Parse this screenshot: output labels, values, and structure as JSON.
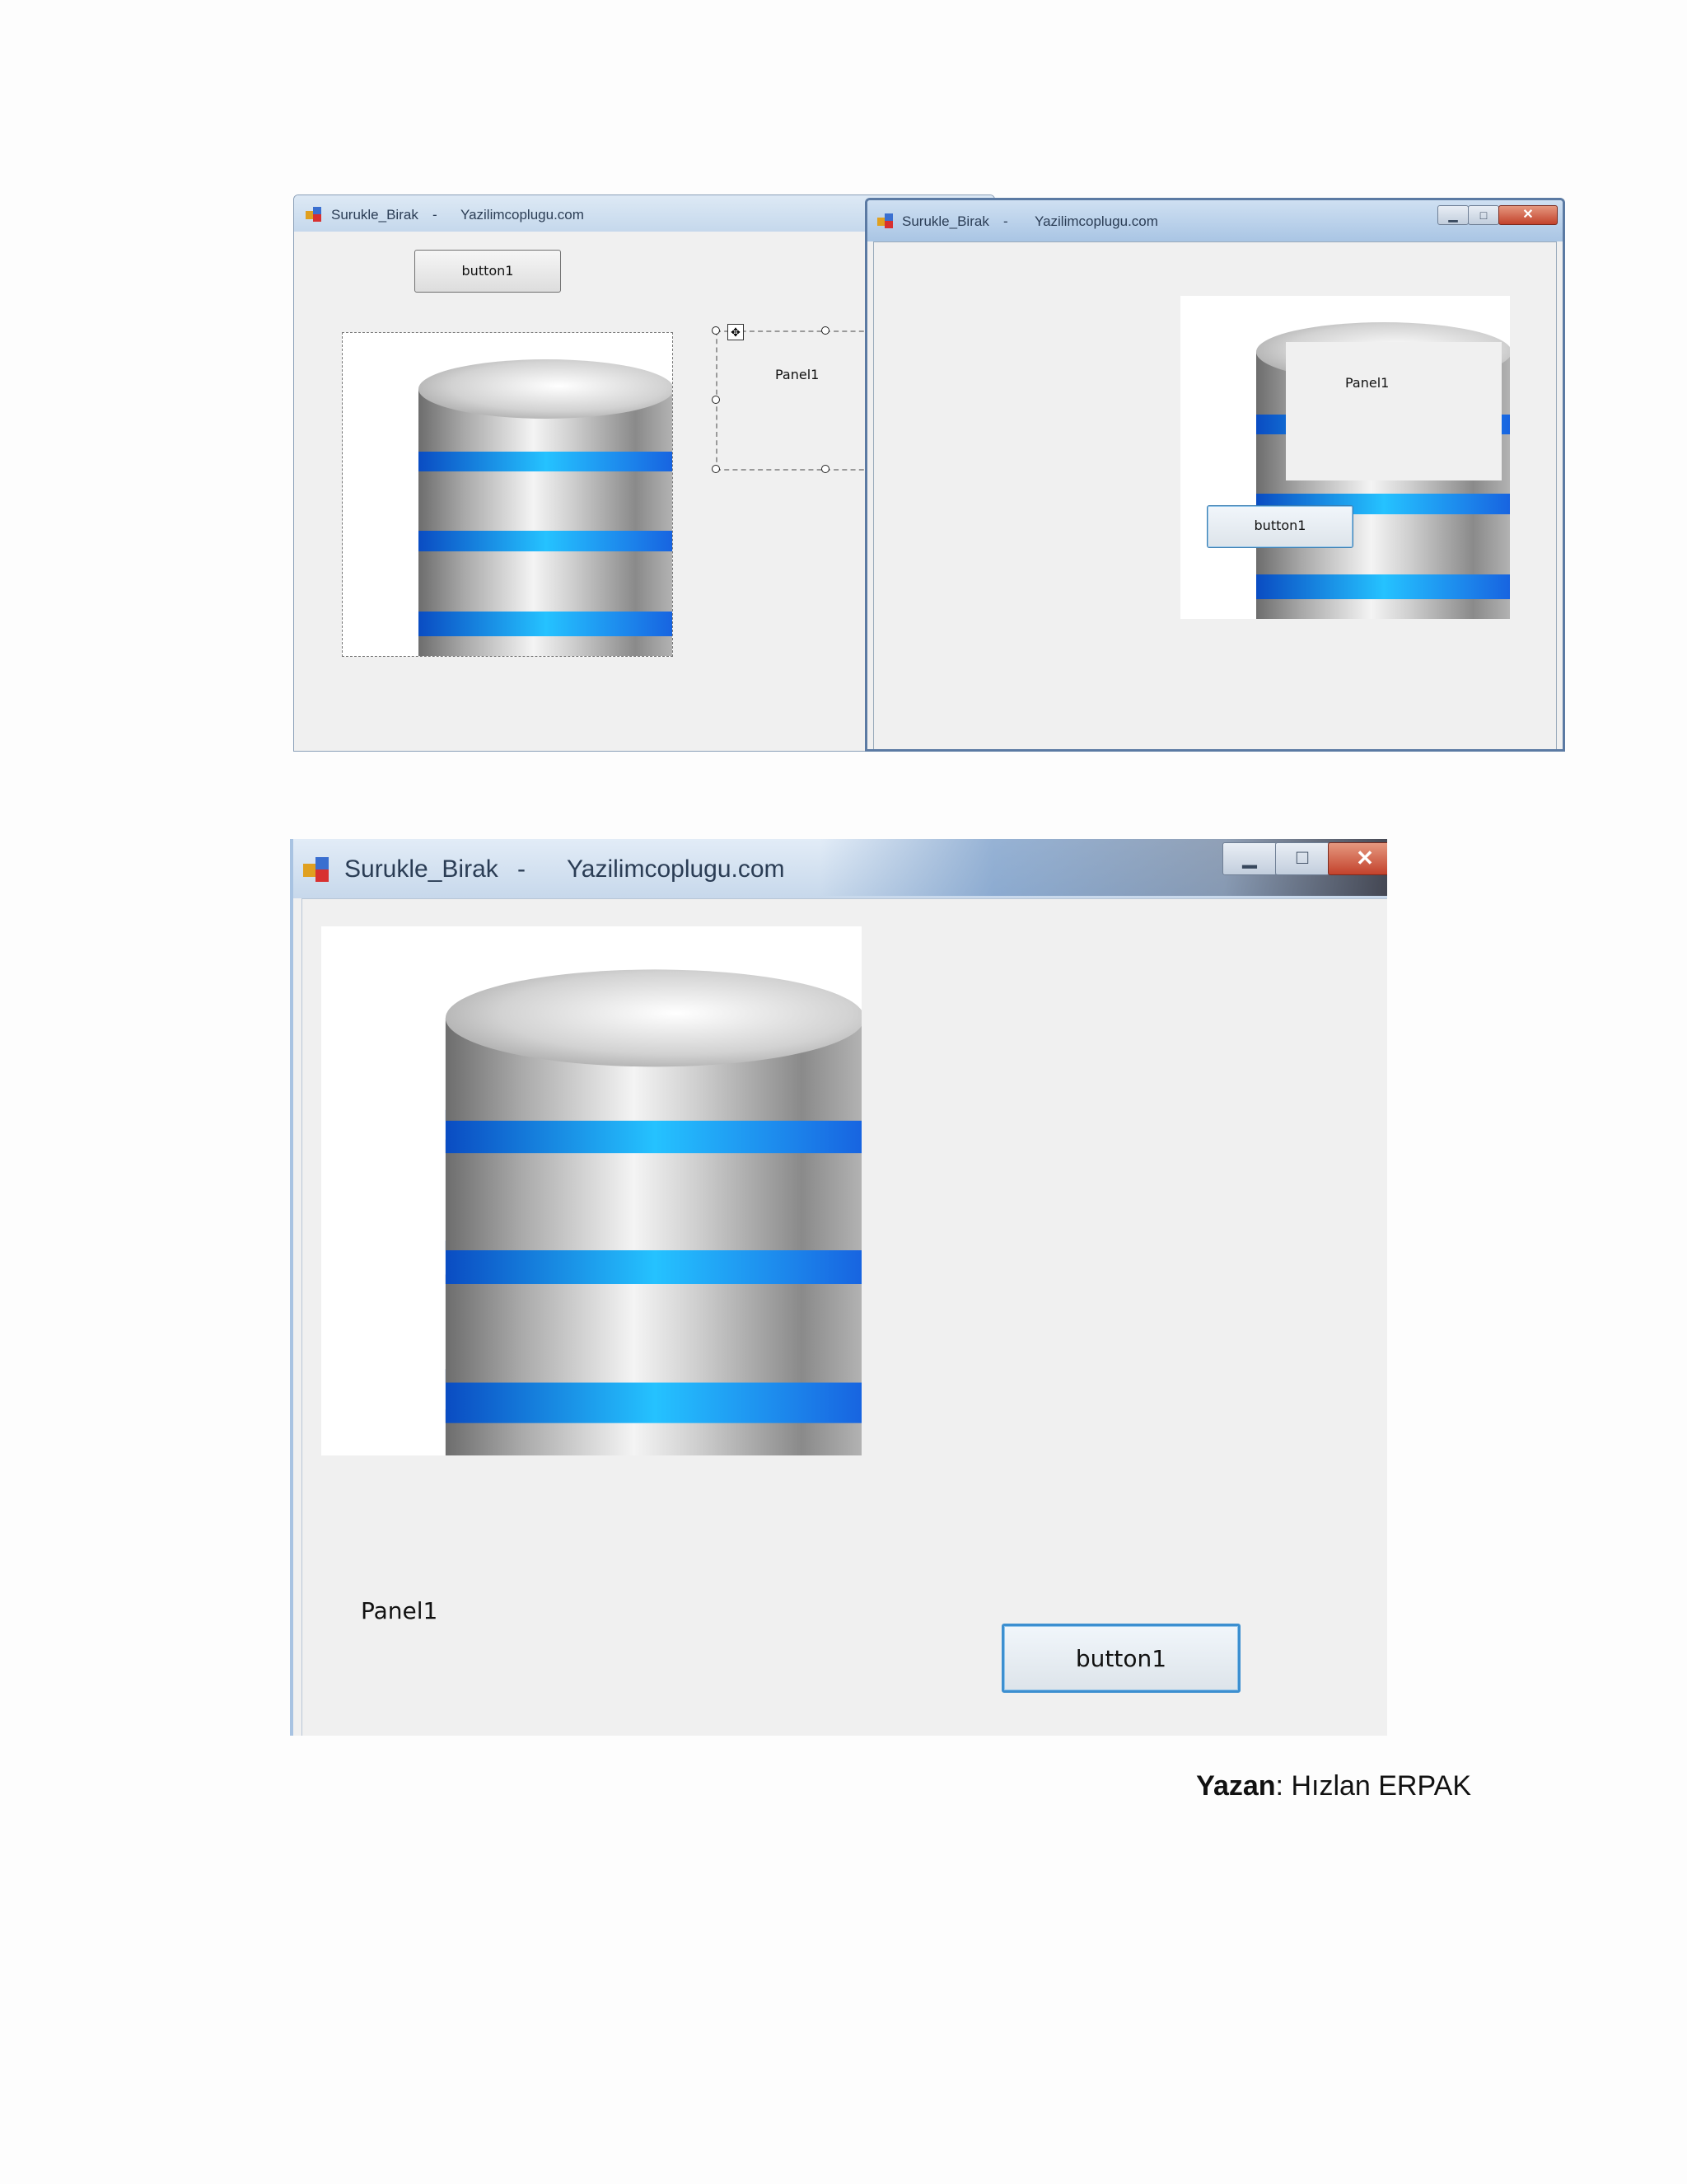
{
  "screenshot1": {
    "left_window": {
      "title": "Surukle_Birak",
      "separator": "-",
      "site": "Yazilimcoplugu.com",
      "button_label": "button1",
      "panel_label": "Panel1"
    },
    "right_window": {
      "title": "Surukle_Birak",
      "separator": "-",
      "site": "Yazilimcoplugu.com",
      "minimize_icon": "minimize-icon",
      "maximize_icon": "maximize-icon",
      "close_icon": "close-icon",
      "panel_label": "Panel1",
      "button_label": "button1"
    }
  },
  "screenshot2": {
    "title": "Surukle_Birak",
    "separator": "-",
    "site": "Yazilimcoplugu.com",
    "panel_label": "Panel1",
    "button_label": "button1"
  },
  "footer": {
    "author_label": "Yazan",
    "author_sep": ": ",
    "author_name": "Hızlan ERPAK"
  },
  "colors": {
    "accent_blue": "#1e88ff",
    "window_bg": "#f0f0f0",
    "close_red": "#c3422c"
  }
}
